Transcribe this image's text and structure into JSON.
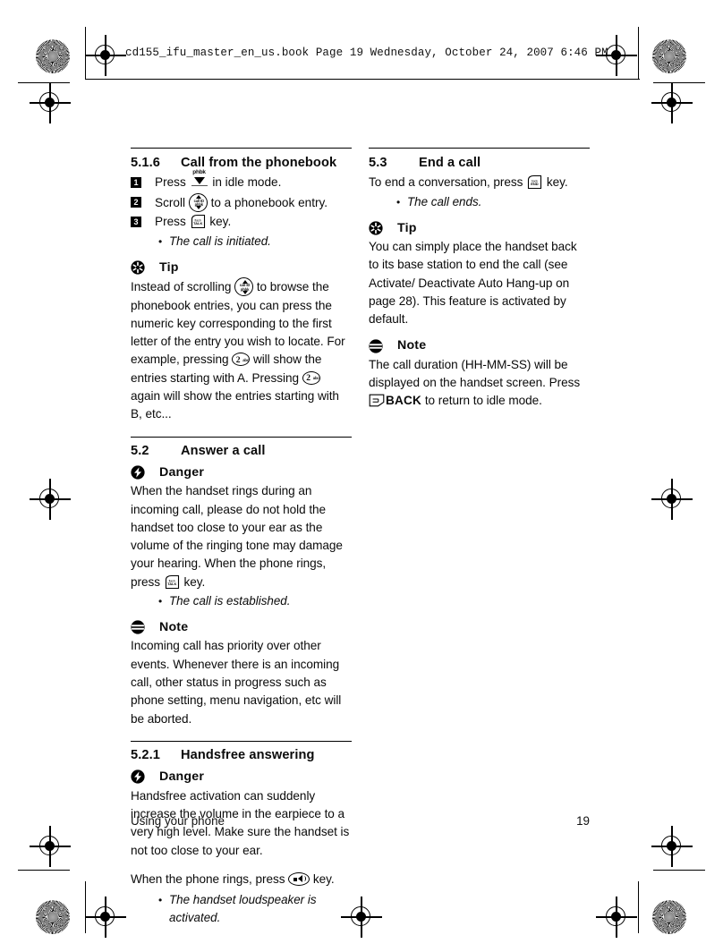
{
  "header": {
    "book_line": "cd155_ifu_master_en_us.book  Page 19  Wednesday, October 24, 2007  6:46 PM"
  },
  "footer": {
    "chapter": "Using your phone",
    "page_number": "19"
  },
  "left_column": {
    "section_516": {
      "number": "5.1.6",
      "title": "Call from the phonebook",
      "steps": [
        {
          "num": "1",
          "pre": "Press",
          "key": "phbk-key",
          "post": "in idle mode."
        },
        {
          "num": "2",
          "pre": "Scroll",
          "key": "scroll-key",
          "post": "to a phonebook entry."
        },
        {
          "num": "3",
          "pre": "Press",
          "key": "talk-key",
          "post": "key."
        }
      ],
      "bullet": "The call is initiated."
    },
    "tip": {
      "label": "Tip",
      "text_part1": "Instead of scrolling",
      "text_part2": "to browse the phonebook entries, you can press the numeric key corresponding to the first letter of the entry you wish to locate. For example, pressing",
      "text_part3": "will show the entries starting with A. Pressing",
      "text_part4": "again will show the entries starting with B, etc..."
    },
    "section_52": {
      "number": "5.2",
      "title": "Answer a call",
      "danger_label": "Danger",
      "danger_text_part1": "When the handset rings during an incoming call, please do not hold the handset too close to your ear as the volume of the ringing tone may damage your hearing. When the phone rings, press",
      "danger_text_part2": "key.",
      "bullet": "The call is established.",
      "note_label": "Note",
      "note_text": "Incoming call has priority over other events. Whenever there is an incoming call, other status in progress such as phone setting, menu navigation, etc will be aborted."
    },
    "section_521": {
      "number": "5.2.1",
      "title": "Handsfree answering",
      "danger_label": "Danger",
      "danger_text": "Handsfree activation can suddenly increase the volume in the earpiece to a very high level. Make sure the handset is not too close to your ear.",
      "ring_text_part1": "When the phone rings, press",
      "ring_text_part2": "key.",
      "bullet": "The handset loudspeaker is activated."
    }
  },
  "right_column": {
    "section_53": {
      "number": "5.3",
      "title": "End a call",
      "text_part1": "To end a conversation, press",
      "text_part2": "key.",
      "bullet": "The call ends.",
      "tip_label": "Tip",
      "tip_text": "You can simply place the handset back to its base station to end the call (see Activate/ Deactivate Auto Hang-up on page 28). This feature is activated by default.",
      "note_label": "Note",
      "note_text_part1": "The call duration (HH-MM-SS) will be displayed on the handset screen. Press",
      "note_back_label": "BACK",
      "note_text_part2": "to return to idle mode."
    }
  },
  "key_glyphs": {
    "phbk": "phbk",
    "scroll_line1": "call ID",
    "scroll_line2": "phbk",
    "talk_line1": "flash",
    "talk_line2": "TALK",
    "end_line1": "back",
    "end_line2": "END",
    "num2_digit": "2",
    "num2_sub": "abc"
  },
  "colors": {
    "ink": "#000000",
    "paper": "#ffffff"
  }
}
